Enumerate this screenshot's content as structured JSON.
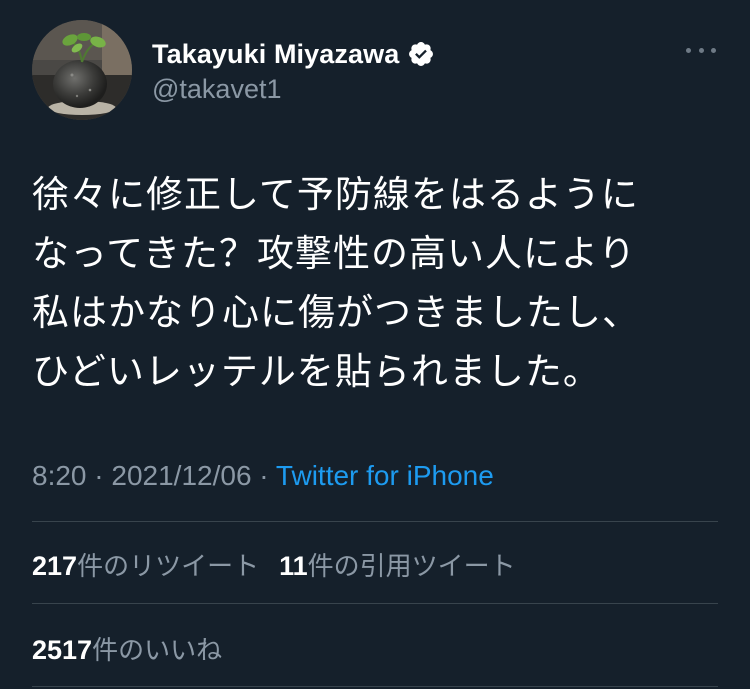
{
  "author": {
    "display_name": "Takayuki Miyazawa",
    "handle": "@takavet1",
    "verified": true
  },
  "tweet": {
    "text_lines": [
      "徐々に修正して予防線をはるように",
      "なってきた？攻撃性の高い人により",
      "私はかなり心に傷がつきましたし、",
      "ひどいレッテルを貼られました。"
    ],
    "time": "8:20",
    "date": "2021/12/06",
    "separator": " · ",
    "source": "Twitter for iPhone"
  },
  "stats": {
    "retweets": {
      "count": "217",
      "label": "件のリツイート"
    },
    "quotes": {
      "count": "11",
      "label": "件の引用ツイート"
    },
    "likes": {
      "count": "2517",
      "label": "件のいいね"
    }
  },
  "colors": {
    "background": "#15202b",
    "text": "#ffffff",
    "secondary": "#8b98a5",
    "link": "#1d9bf0",
    "divider": "#38444d",
    "verified_badge": "#ffffff"
  },
  "icons": {
    "avatar": "avatar-photo",
    "verified": "verified-badge-icon",
    "more": "more-options-icon"
  }
}
